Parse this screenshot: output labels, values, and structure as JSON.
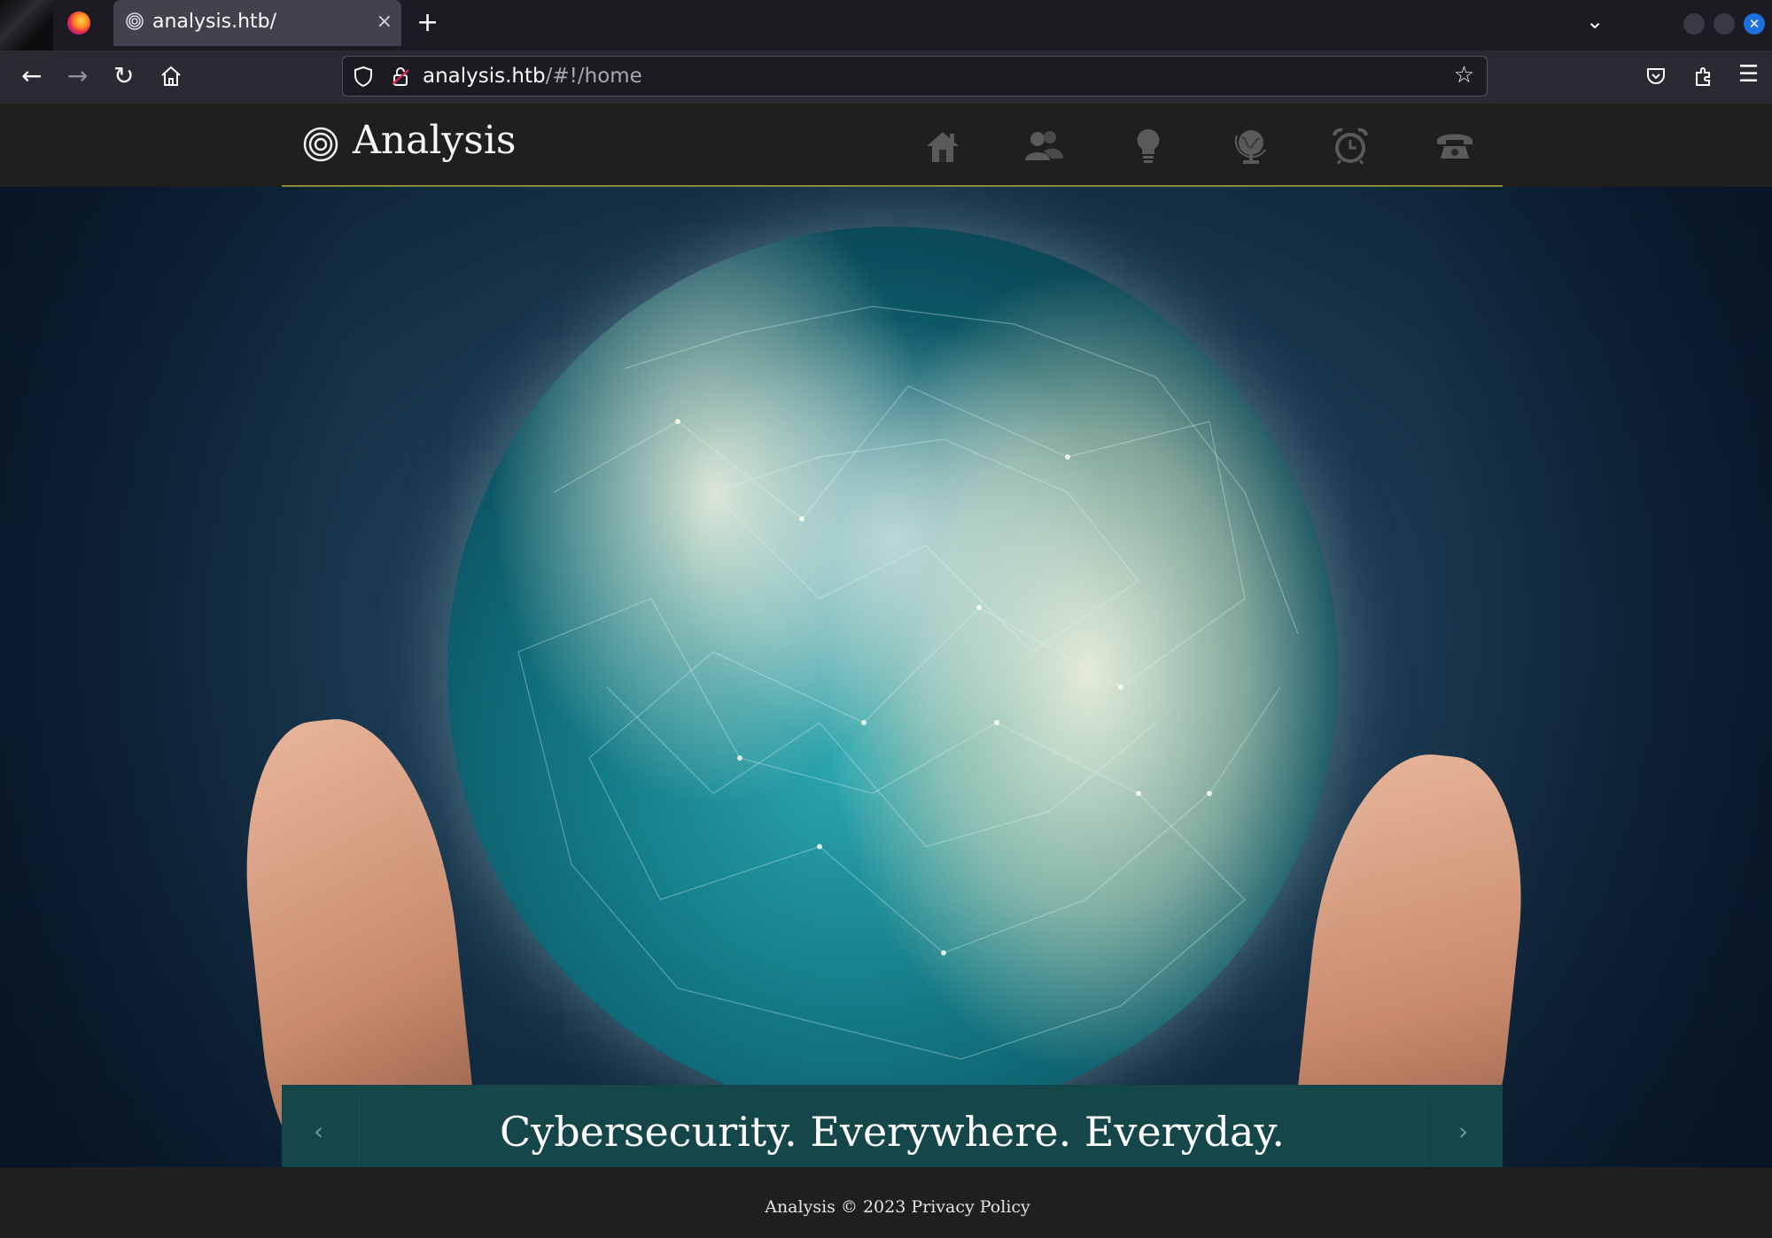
{
  "browser": {
    "tab_title": "analysis.htb/",
    "tab_close": "×",
    "new_tab": "+",
    "url_host": "analysis.htb",
    "url_path": "/#!/home"
  },
  "site": {
    "brand": "Analysis",
    "nav": [
      "home-icon",
      "users-icon",
      "lightbulb-icon",
      "globe-icon",
      "alarm-clock-icon",
      "phone-icon"
    ],
    "nav_color": "#5a5a5a",
    "accent_color": "#8a8a3a"
  },
  "carousel": {
    "caption": "Cybersecurity. Everywhere. Everyday.",
    "prev": "‹",
    "next": "›",
    "caption_bg": "#14464a"
  },
  "footer": {
    "text": "Analysis © 2023 Privacy Policy"
  }
}
